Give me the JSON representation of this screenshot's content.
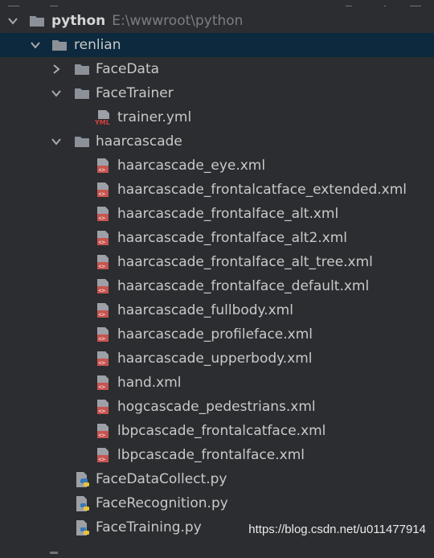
{
  "project": {
    "name": "python",
    "path": "E:\\wwwroot\\python"
  },
  "tree": {
    "renlian": "renlian",
    "facedata": "FaceData",
    "facetrainer": "FaceTrainer",
    "trainer_file": "trainer.yml",
    "haarcascade_folder": "haarcascade",
    "xml_files": [
      "haarcascade_eye.xml",
      "haarcascade_frontalcatface_extended.xml",
      "haarcascade_frontalface_alt.xml",
      "haarcascade_frontalface_alt2.xml",
      "haarcascade_frontalface_alt_tree.xml",
      "haarcascade_frontalface_default.xml",
      "haarcascade_fullbody.xml",
      "haarcascade_profileface.xml",
      "haarcascade_upperbody.xml",
      "hand.xml",
      "hogcascade_pedestrians.xml",
      "lbpcascade_frontalcatface.xml",
      "lbpcascade_frontalface.xml"
    ],
    "py_files": [
      "FaceDataCollect.py",
      "FaceRecognition.py",
      "FaceTraining.py"
    ]
  },
  "icons": {
    "folder": "folder-icon",
    "xml": "xml-file-icon",
    "yml": "yml-file-icon",
    "python": "python-file-icon",
    "expanded": "chevron-down-icon",
    "collapsed": "chevron-right-icon"
  },
  "yml_badge": "YML",
  "watermark": "https://blog.csdn.net/u011477914",
  "colors": {
    "background": "#2b2d30",
    "selected_row": "#0d293e",
    "folder": "#8c9098",
    "xml_icon": "#c75450",
    "text": "#c9c9c9"
  }
}
